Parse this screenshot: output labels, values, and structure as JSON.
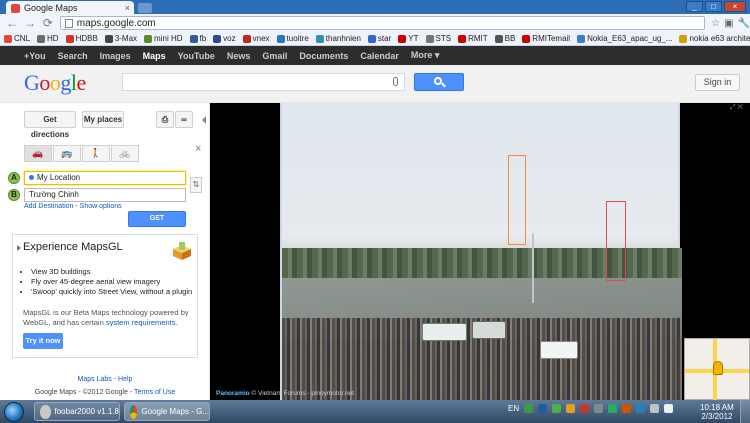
{
  "browser": {
    "tab_title": "Google Maps",
    "url": "maps.google.com",
    "bookmarks": [
      "CNL",
      "HD",
      "HDBB",
      "3-Max",
      "mini HD",
      "fb",
      "voz",
      "vnex",
      "tuoitre",
      "thanhnien",
      "star",
      "YT",
      "STS",
      "RMIT",
      "BB",
      "RMITemail",
      "Nokia_E63_apac_ug_...",
      "nokia e63 architecture"
    ],
    "bookmark_colors": [
      "#e0473c",
      "#6a6a6a",
      "#d9332c",
      "#444444",
      "#5a8a2a",
      "#3b5998",
      "#2a4c8c",
      "#c2271e",
      "#2b72c9",
      "#3a8ac0",
      "#3366cc",
      "#cc0000",
      "#777777",
      "#cc0000",
      "#555555",
      "#cc0000",
      "#3b7bd0",
      "#c9a100"
    ]
  },
  "gbar": {
    "items": [
      "+You",
      "Search",
      "Images",
      "Maps",
      "YouTube",
      "News",
      "Gmail",
      "Documents",
      "Calendar",
      "More ▾"
    ],
    "active": "Maps"
  },
  "header": {
    "logo": "Google",
    "logo_colors": [
      "#3369e8",
      "#d50f25",
      "#eeb211",
      "#3369e8",
      "#009925",
      "#d50f25"
    ],
    "sign_in": "Sign in"
  },
  "panel": {
    "get_directions": "Get directions",
    "my_places": "My places",
    "close": "×",
    "marker_a": "A",
    "marker_b": "B",
    "from": "My Location",
    "to": "Trường Chinh",
    "add_destination": "Add Destination",
    "show_options": "Show options",
    "get_directions_btn": "GET DIRECTIONS",
    "mapsgl": {
      "title": "Experience MapsGL",
      "bullets": [
        "View 3D buildings",
        "Fly over 45-degree aerial view imagery",
        "'Swoop' quickly into Street View, without a plugin"
      ],
      "desc": "MapsGL is our Beta Maps technology powered by WebGL, and has certain",
      "desc_link": "system requirements",
      "try_it": "Try it now"
    },
    "labs": "Maps Labs",
    "help": "Help",
    "copyright": "Google Maps - ©2012 Google -",
    "terms": "Terms of Use"
  },
  "map": {
    "credit_brand": "Panoramio",
    "credit_text": "© Vietnam Forums - pinoymotor.net"
  },
  "taskbar": {
    "tasks": [
      "foobar2000 v1.1.8",
      "Google Maps - G..."
    ],
    "lang": "EN",
    "time": "10:18 AM",
    "date": "2/3/2012"
  }
}
